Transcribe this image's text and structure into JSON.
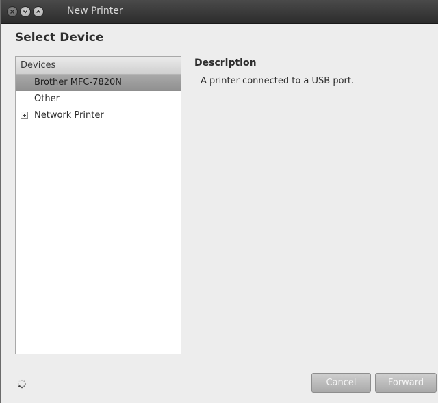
{
  "window": {
    "title": "New Printer"
  },
  "page": {
    "heading": "Select Device"
  },
  "devices": {
    "header": "Devices",
    "items": [
      {
        "label": "Brother MFC-7820N",
        "selected": true,
        "expandable": false
      },
      {
        "label": "Other",
        "selected": false,
        "expandable": false
      },
      {
        "label": "Network Printer",
        "selected": false,
        "expandable": true
      }
    ]
  },
  "description": {
    "title": "Description",
    "text": "A printer connected to a USB port."
  },
  "buttons": {
    "cancel": "Cancel",
    "forward": "Forward"
  },
  "icons": {
    "close": "close-icon",
    "minimize": "minimize-icon",
    "maximize": "maximize-icon",
    "busy": "busy-spinner-icon",
    "expander": "expand-plus-icon"
  }
}
